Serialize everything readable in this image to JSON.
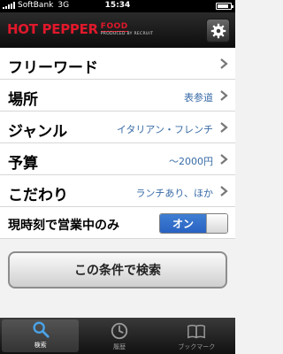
{
  "status_bar": {
    "carrier": "SoftBank",
    "network": "3G",
    "time": "15:34"
  },
  "header": {
    "logo_main": "HOT PEPPER",
    "logo_sub": "FOOD",
    "logo_by": "PRODUCED BY RECRUIT",
    "settings_icon": "gear-icon"
  },
  "rows": [
    {
      "label": "フリーワード",
      "value": ""
    },
    {
      "label": "場所",
      "value": "表参道"
    },
    {
      "label": "ジャンル",
      "value": "イタリアン・フレンチ"
    },
    {
      "label": "予算",
      "value": "〜2000円"
    },
    {
      "label": "こだわり",
      "value": "ランチあり、ほか"
    }
  ],
  "open_now": {
    "label": "現時刻で営業中のみ",
    "toggle_label": "オン",
    "state": "on"
  },
  "search_button": {
    "label": "この条件で検索"
  },
  "tabs": [
    {
      "label": "検索",
      "icon": "search-icon",
      "active": true
    },
    {
      "label": "履歴",
      "icon": "clock-icon",
      "active": false
    },
    {
      "label": "ブックマーク",
      "icon": "bookmark-book-icon",
      "active": false
    }
  ],
  "colors": {
    "accent_red": "#e0182b",
    "value_blue": "#386ba6",
    "toggle_blue": "#2a62c2"
  }
}
